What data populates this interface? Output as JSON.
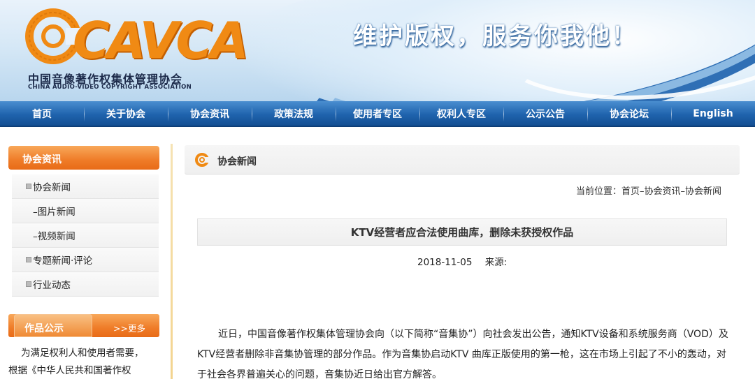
{
  "header": {
    "logo_text": "CAVCA",
    "org_name_cn": "中国音像著作权集体管理协会",
    "org_name_en": "CHINA AUDIO-VIDEO COPYRIGHT ASSOCIATION",
    "slogan": "维护版权，服务你我他！"
  },
  "nav": {
    "items": [
      {
        "label": "首页"
      },
      {
        "label": "关于协会"
      },
      {
        "label": "协会资讯"
      },
      {
        "label": "政策法规"
      },
      {
        "label": "使用者专区"
      },
      {
        "label": "权利人专区"
      },
      {
        "label": "公示公告"
      },
      {
        "label": "协会论坛"
      },
      {
        "label": "English"
      }
    ]
  },
  "sidebar": {
    "title": "协会资讯",
    "items": [
      {
        "label": "协会新闻"
      },
      {
        "label": "–图片新闻"
      },
      {
        "label": "–视频新闻"
      },
      {
        "label": "专题新闻·评论"
      },
      {
        "label": "行业动态"
      }
    ],
    "works": {
      "title": "作品公示",
      "more": ">>更多",
      "text_line1": "为满足权利人和使用者需要，",
      "text_line2": "根据《中华人民共和国著作权"
    }
  },
  "main": {
    "section_title": "协会新闻",
    "breadcrumb": "当前位置：首页–协会资讯–协会新闻",
    "article": {
      "title": "KTV经营者应合法使用曲库，删除未获授权作品",
      "date": "2018-11-05",
      "source_label": "来源:",
      "paragraph": "近日，中国音像著作权集体管理协会向（以下简称“音集协”）向社会发出公告，通知KTV设备和系统服务商（VOD）及KTV经营者删除非音集协管理的部分作品。作为音集协启动KTV 曲库正版使用的第一枪，这在市场上引起了不小的轰动，对于社会各界普遍关心的问题，音集协近日给出官方解答。"
    }
  },
  "colors": {
    "nav_blue": "#1f63ad",
    "accent_orange": "#ef7c28",
    "logo_orange": "#f08a14"
  }
}
